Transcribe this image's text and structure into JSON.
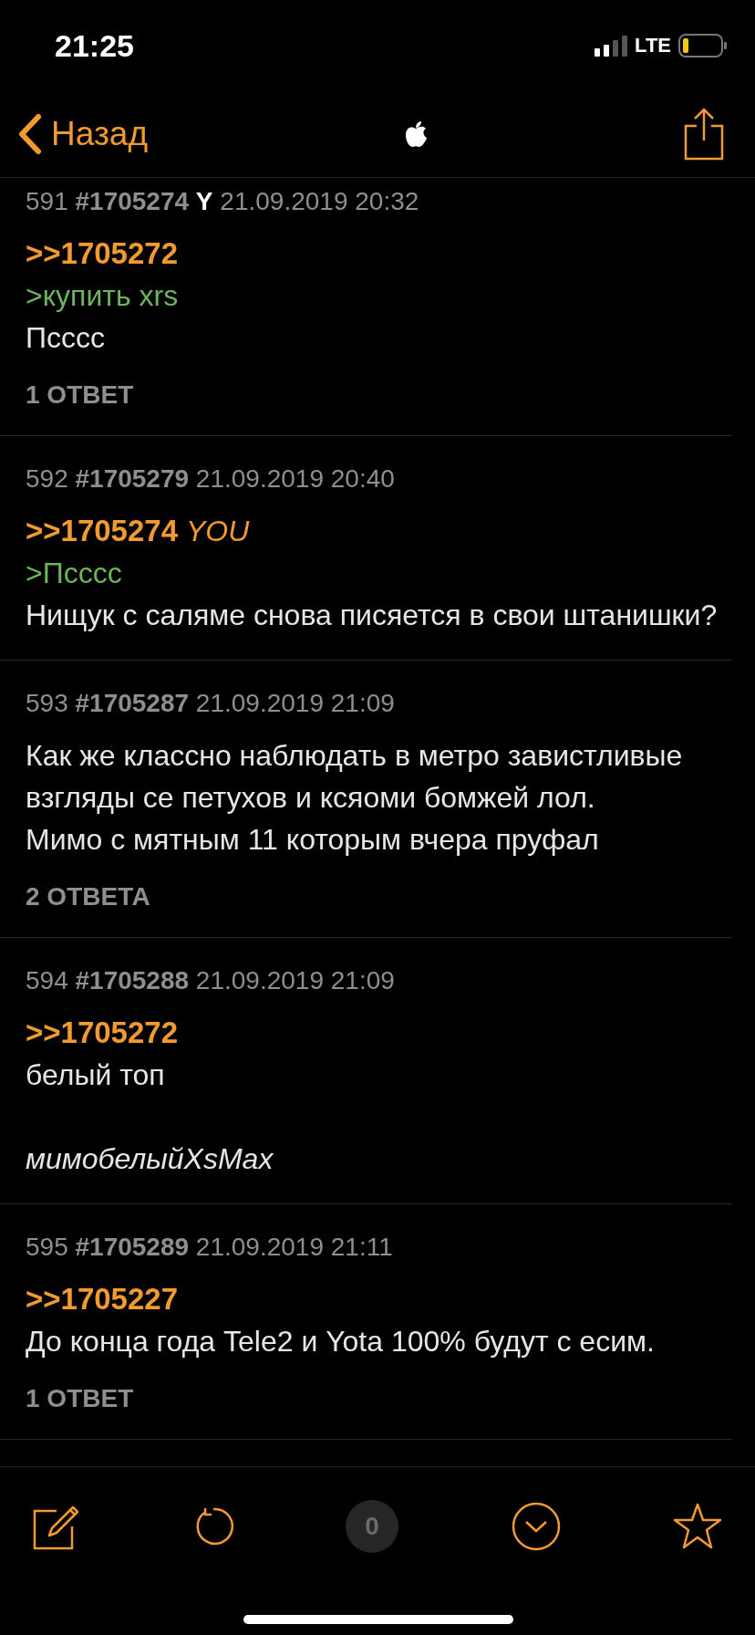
{
  "status_bar": {
    "time": "21:25",
    "network": "LTE"
  },
  "nav": {
    "back": "Назад"
  },
  "posts": [
    {
      "number": "591",
      "id": "#1705274",
      "mark": "Y",
      "date": "21.09.2019 20:32",
      "lines": [
        {
          "kind": "reply_link",
          "text": ">>1705272"
        },
        {
          "kind": "quote",
          "text": ">купить xrs"
        },
        {
          "kind": "text",
          "text": "Псссс"
        }
      ],
      "replies": "1 ОТВЕТ"
    },
    {
      "number": "592",
      "id": "#1705279",
      "date": "21.09.2019 20:40",
      "lines": [
        {
          "kind": "reply_link",
          "text": ">>1705274",
          "tag": "YOU"
        },
        {
          "kind": "quote",
          "text": ">Псссс"
        },
        {
          "kind": "text",
          "text": "Нищук с саляме снова писяется в свои штанишки?"
        }
      ]
    },
    {
      "number": "593",
      "id": "#1705287",
      "date": "21.09.2019 21:09",
      "lines": [
        {
          "kind": "text",
          "text": "Как же классно наблюдать в метро завистливые взгляды се петухов и ксяоми бомжей лол."
        },
        {
          "kind": "text",
          "text": "Мимо с мятным 11 которым вчера пруфал"
        }
      ],
      "replies": "2 ОТВЕТА"
    },
    {
      "number": "594",
      "id": "#1705288",
      "date": "21.09.2019 21:09",
      "lines": [
        {
          "kind": "reply_link",
          "text": ">>1705272"
        },
        {
          "kind": "text",
          "text": "белый топ"
        },
        {
          "kind": "signature",
          "text": "мимобелыйXsMax"
        }
      ]
    },
    {
      "number": "595",
      "id": "#1705289",
      "date": "21.09.2019 21:11",
      "lines": [
        {
          "kind": "reply_link",
          "text": ">>1705227"
        },
        {
          "kind": "text",
          "text": "До конца года Tele2 и Yota 100% будут с есим."
        }
      ],
      "replies": "1 ОТВЕТ"
    }
  ],
  "toolbar": {
    "counter": "0"
  }
}
